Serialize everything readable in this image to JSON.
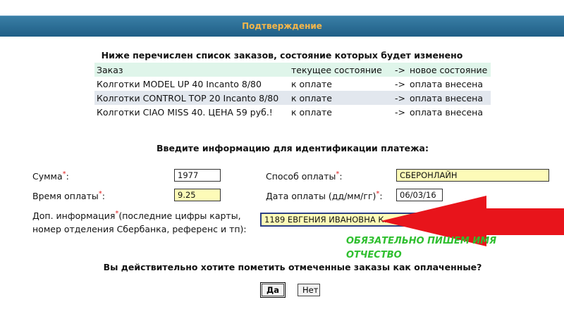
{
  "header": {
    "title": "Подтверждение"
  },
  "orders": {
    "heading": "Ниже перечислен список заказов, состояние которых будет изменено",
    "columns": {
      "name": "Заказ",
      "current": "текущее состояние",
      "arrow": "->",
      "new": "новое состояние"
    },
    "rows": [
      {
        "name": "Колготки MODEL UP 40 Incanto 8/80",
        "current": "к оплате",
        "arrow": "->",
        "new": "оплата внесена"
      },
      {
        "name": "Колготки CONTROL TOP 20 Incanto 8/80",
        "current": "к оплате",
        "arrow": "->",
        "new": "оплата внесена"
      },
      {
        "name": "Колготки CIAO MISS 40. ЦЕНА 59 руб.!",
        "current": "к оплате",
        "arrow": "->",
        "new": "оплата внесена"
      }
    ]
  },
  "payment": {
    "heading": "Введите информацию для идентификации платежа:",
    "required_mark": "*",
    "amount": {
      "label": "Сумма",
      "suffix": ":",
      "value": "1977"
    },
    "method": {
      "label": "Способ оплаты",
      "suffix": ":",
      "value": "СБЕРОНЛАЙН"
    },
    "time": {
      "label": "Время оплаты",
      "suffix": ":",
      "value": "9.25"
    },
    "date": {
      "label": "Дата оплаты (дд/мм/гг)",
      "suffix": ":",
      "value": "06/03/16"
    },
    "extra": {
      "label_line1": "Доп. информация",
      "label_line1_rest": "(последние цифры карты,",
      "label_line2": "номер отделения Сбербанка, референс и тп):",
      "value": "1189 ЕВГЕНИЯ ИВАНОВНА К."
    }
  },
  "annotation": {
    "line1": "ОБЯЗАТЕЛЬНО ПИШЕМ  ИМЯ",
    "line2": "ОТЧЕСТВО",
    "color": "#2fbf2f",
    "arrow_color": "#e8141b"
  },
  "confirm": {
    "question": "Вы действительно хотите пометить отмеченные заказы как оплаченные?",
    "yes": "Да",
    "no": "Нет"
  }
}
